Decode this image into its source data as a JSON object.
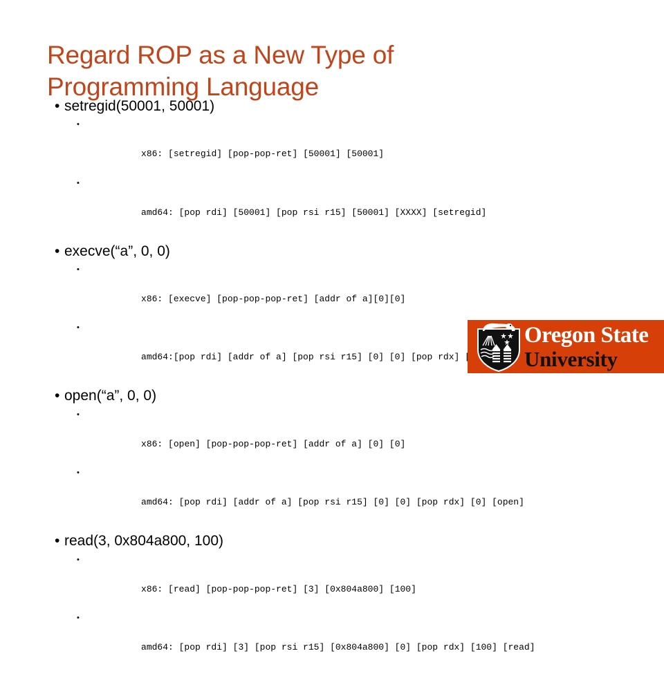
{
  "slide": {
    "title": "Regard ROP as a New Type of\nProgramming Language",
    "title_color": "#c0451a",
    "background": "#ffffff"
  },
  "bullet_glyph": "•",
  "groups": [
    {
      "heading": "setregid(50001, 50001)",
      "lines": [
        {
          "arch": "x86:",
          "gadgets": " [setregid] [pop-pop-ret] [50001] [50001]"
        },
        {
          "arch": "amd64:",
          "gadgets": " [pop rdi] [50001] [pop rsi r15] [50001] [XXXX] [setregid]"
        }
      ]
    },
    {
      "heading": "execve(“a”, 0, 0)",
      "lines": [
        {
          "arch": "x86:",
          "gadgets": " [execve] [pop-pop-pop-ret] [addr of a][0][0]"
        },
        {
          "arch": "amd64:",
          "gadgets": "[pop rdi] [addr of a] [pop rsi r15] [0] [0] [pop rdx] [0] [execve]"
        }
      ]
    },
    {
      "heading": "open(“a”, 0, 0)",
      "lines": [
        {
          "arch": "x86:",
          "gadgets": " [open] [pop-pop-pop-ret] [addr of a] [0] [0]"
        },
        {
          "arch": "amd64:",
          "gadgets": " [pop rdi] [addr of a] [pop rsi r15] [0] [0] [pop rdx] [0] [open]"
        }
      ]
    },
    {
      "heading": "read(3, 0x804a800, 100)",
      "lines": [
        {
          "arch": "x86:",
          "gadgets": " [read] [pop-pop-pop-ret] [3] [0x804a800] [100]"
        },
        {
          "arch": "amd64:",
          "gadgets": " [pop rdi] [3] [pop rsi r15] [0x804a800] [0] [pop rdx] [100] [read]"
        }
      ]
    }
  ],
  "logo": {
    "line1": "Oregon State",
    "line2": "University",
    "background_color": "#d73f09",
    "line1_color": "#ffffff",
    "line2_color": "#111111"
  }
}
